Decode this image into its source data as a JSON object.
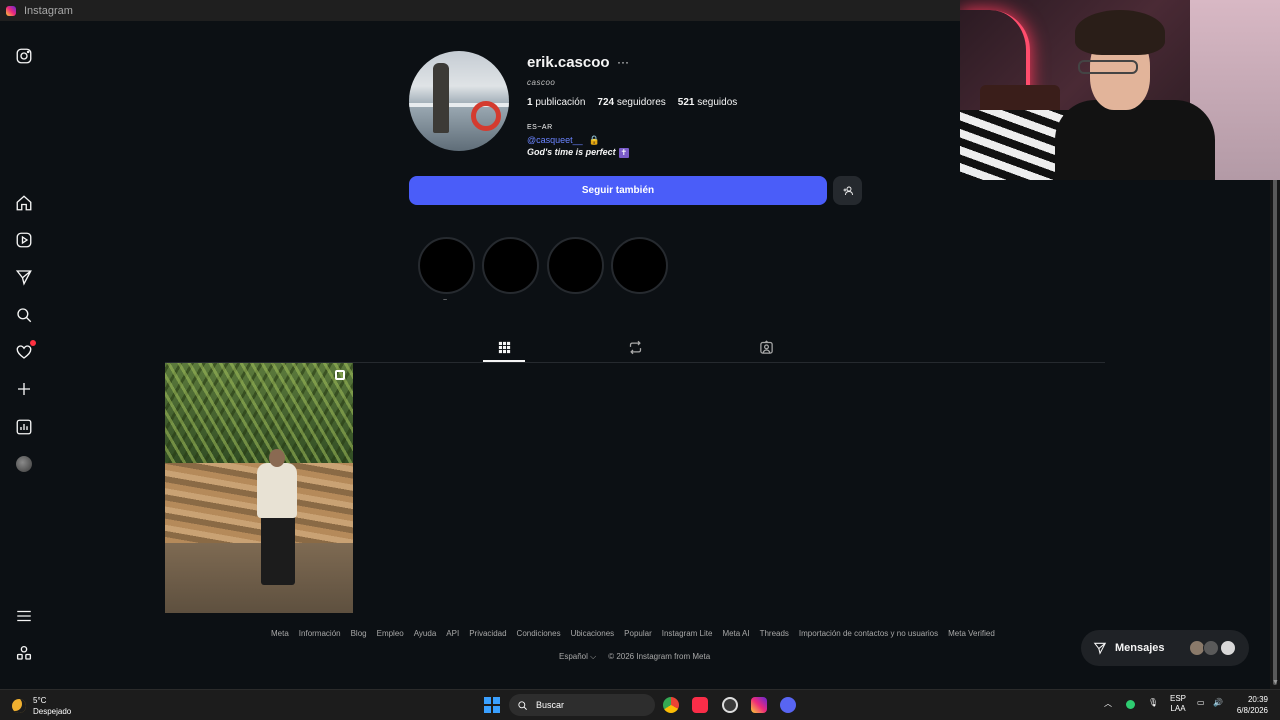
{
  "window": {
    "title": "Instagram"
  },
  "sidebar": {
    "icons": [
      "instagram-logo",
      "home",
      "reels",
      "messages",
      "search",
      "notifications",
      "create",
      "dashboard",
      "profile",
      "menu",
      "more-apps"
    ]
  },
  "profile": {
    "username": "erik.cascoo",
    "more": "···",
    "display_name": "cascoo",
    "stats": {
      "posts_count": "1",
      "posts_label": "publicación",
      "followers_count": "724",
      "followers_label": "seguidores",
      "following_count": "521",
      "following_label": "seguidos"
    },
    "bio_line1": "ES~AR",
    "bio_link": "@casqueet__",
    "bio_line3": "God's time is perfect",
    "follow_button": "Seguir también",
    "highlight_label": "~"
  },
  "footer": {
    "links": [
      "Meta",
      "Información",
      "Blog",
      "Empleo",
      "Ayuda",
      "API",
      "Privacidad",
      "Condiciones",
      "Ubicaciones",
      "Popular",
      "Instagram Lite",
      "Meta AI",
      "Threads",
      "Importación de contactos y no usuarios",
      "Meta Verified"
    ],
    "language": "Español ⌵",
    "copyright": "© 2026 Instagram from Meta"
  },
  "messages_bar": {
    "label": "Mensajes"
  },
  "taskbar": {
    "weather_temp": "5°C",
    "weather_desc": "Despejado",
    "search_placeholder": "Buscar",
    "lang1": "ESP",
    "lang2": "LAA",
    "time": "20:39",
    "date": "6/8/2026"
  },
  "colors": {
    "accent": "#4a5df9",
    "background": "#0c1014",
    "link": "#6b84ff"
  }
}
